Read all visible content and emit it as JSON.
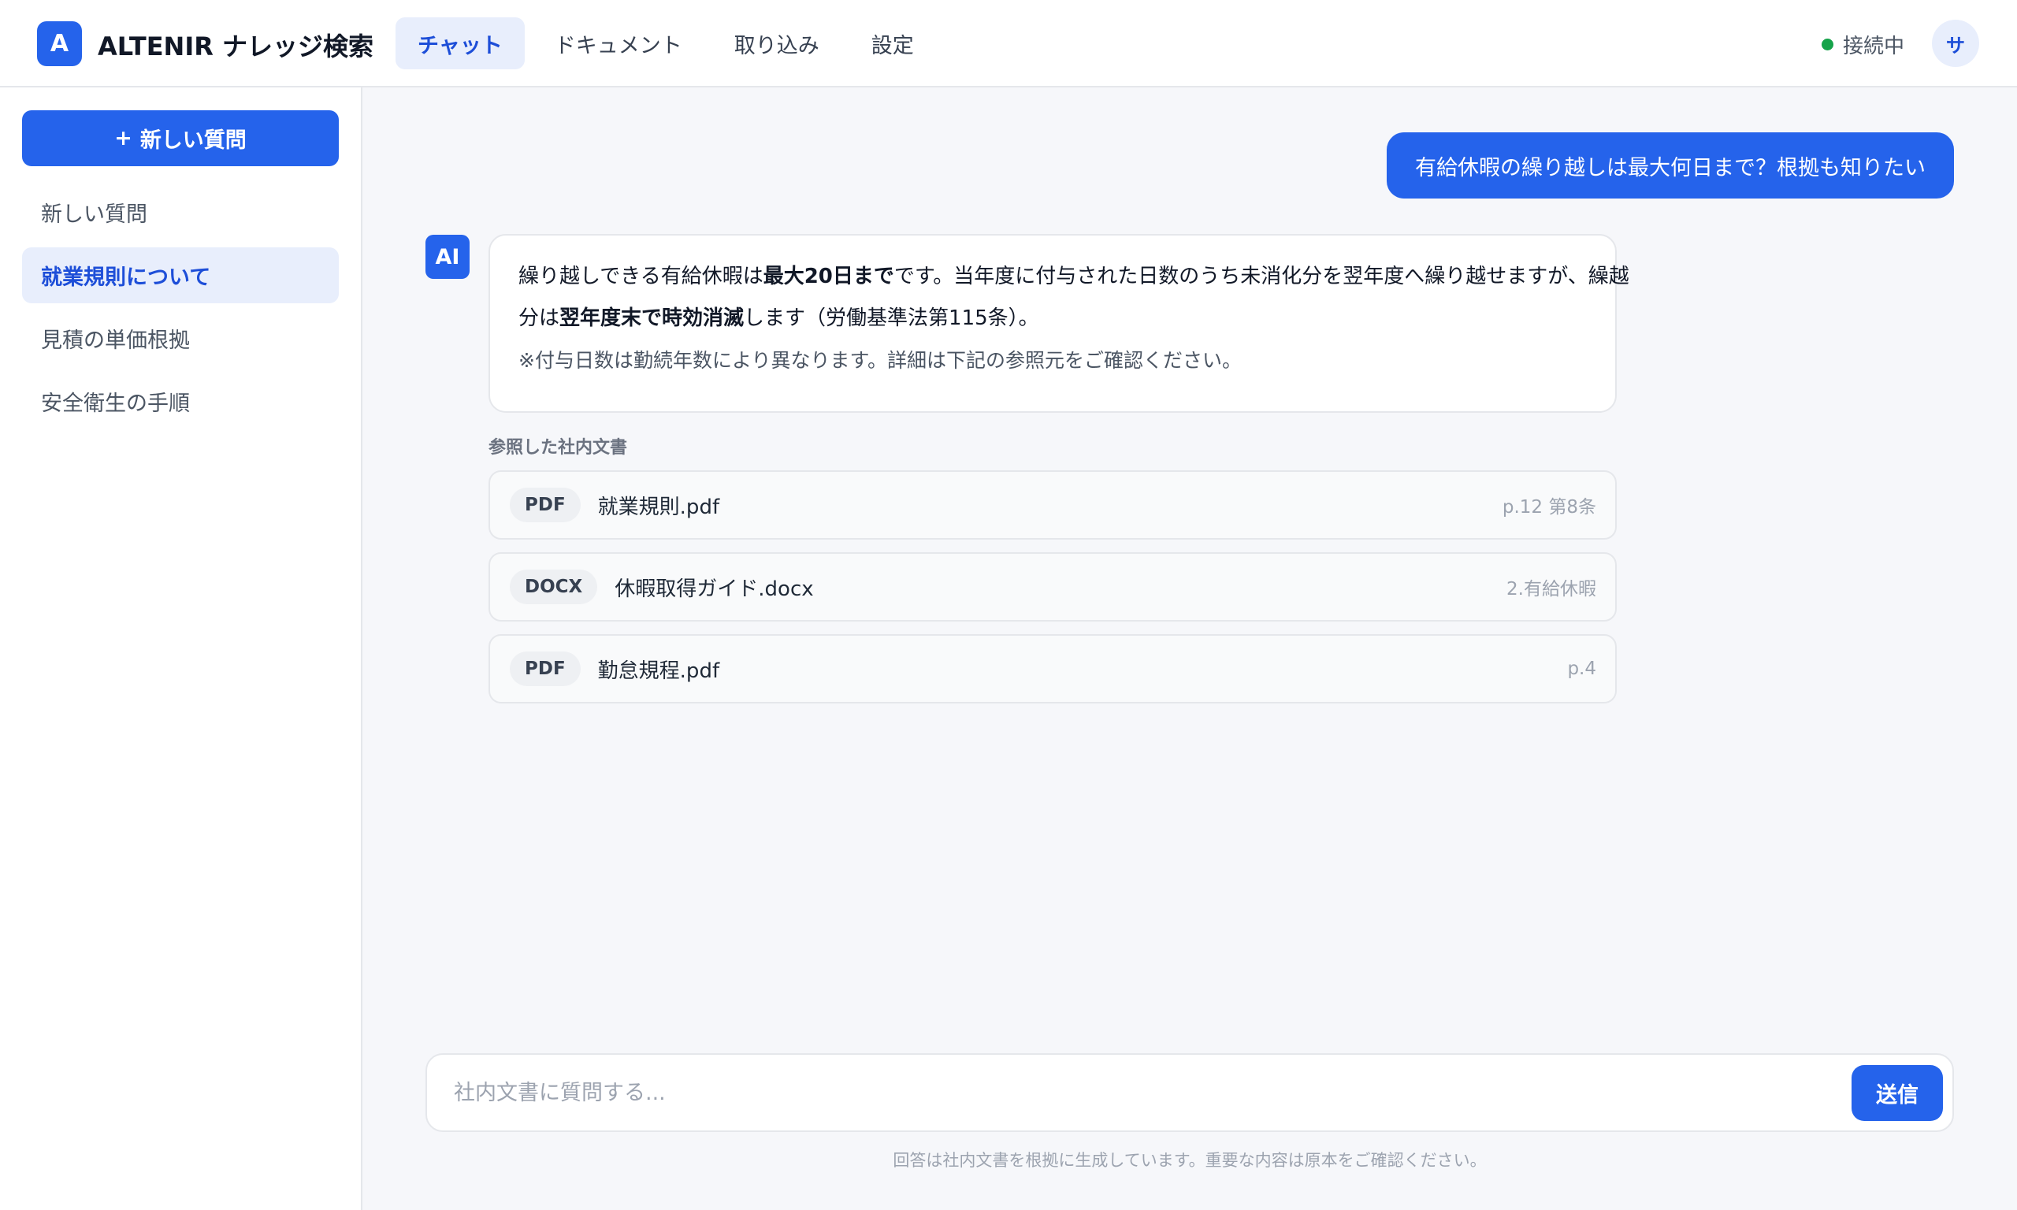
{
  "header": {
    "logo_letter": "A",
    "brand": "ALTENIR ナレッジ検索",
    "tabs": [
      {
        "label": "チャット",
        "active": true
      },
      {
        "label": "ドキュメント",
        "active": false
      },
      {
        "label": "取り込み",
        "active": false
      },
      {
        "label": "設定",
        "active": false
      }
    ],
    "status": "接続中",
    "avatar": "サ"
  },
  "sidebar": {
    "new_button": "新しい質問",
    "new_button_icon": "+",
    "items": [
      {
        "label": "新しい質問",
        "active": false
      },
      {
        "label": "就業規則について",
        "active": true
      },
      {
        "label": "見積の単価根拠",
        "active": false
      },
      {
        "label": "安全衛生の手順",
        "active": false
      }
    ]
  },
  "chat": {
    "user_message": "有給休暇の繰り越しは最大何日まで？根拠も知りたい",
    "ai_avatar": "AI",
    "ai_answer": {
      "l1_a": "繰り越しできる有給休暇は",
      "l1_b": "最大20日まで",
      "l1_c": "です。当年度に付与された日数のうち未消化分を翌年度へ繰り越せますが、繰越",
      "l2_a": "分は",
      "l2_b": "翌年度末で時効消滅",
      "l2_c": "します（労働基準法第115条）。",
      "note": "※付与日数は勤続年数により異なります。詳細は下記の参照元をご確認ください。"
    },
    "refs_label": "参照した社内文書",
    "refs": [
      {
        "type": "PDF",
        "name": "就業規則.pdf",
        "location": "p.12 第8条"
      },
      {
        "type": "DOCX",
        "name": "休暇取得ガイド.docx",
        "location": "2.有給休暇"
      },
      {
        "type": "PDF",
        "name": "勤怠規程.pdf",
        "location": "p.4"
      }
    ]
  },
  "composer": {
    "placeholder": "社内文書に質問する...",
    "send": "送信",
    "disclaimer": "回答は社内文書を根拠に生成しています。重要な内容は原本をご確認ください。"
  },
  "colors": {
    "accent": "#2563eb",
    "status_ok": "#16a34a",
    "active_bg": "#e8eefc"
  }
}
